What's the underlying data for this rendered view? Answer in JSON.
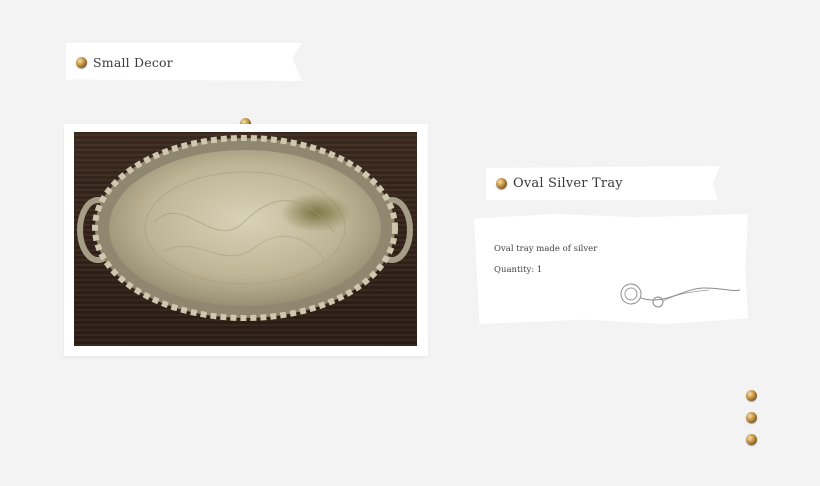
{
  "category": {
    "label": "Small Decor"
  },
  "product": {
    "title": "Oval Silver Tray",
    "description": "Oval tray made of silver",
    "quantity": "Quantity: 1"
  },
  "colors": {
    "background": "#f3f3f3",
    "paper": "#ffffff",
    "pin": "#c08d3a",
    "wood": "#3b2a1f",
    "silver": "#c9c2a8"
  },
  "icons": {
    "pin": "brass-pin-icon",
    "doodle": "flower-sketch-icon"
  }
}
